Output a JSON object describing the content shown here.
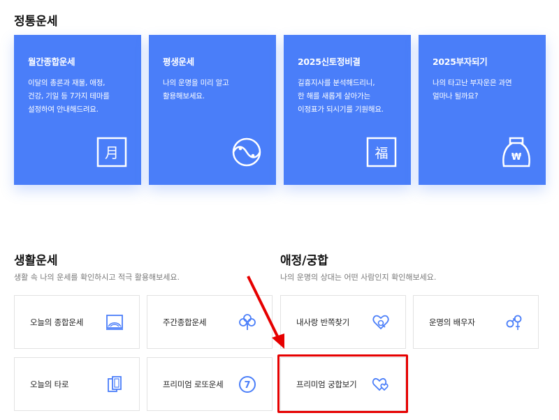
{
  "fortune": {
    "title": "정통운세",
    "cards": [
      {
        "title": "월간종합운세",
        "desc": "이달의 총론과 재물, 애정,\n건강, 기일 등 7가지 테마를\n설정하여 안내해드려요.",
        "icon": "calendar-month-icon",
        "glyph": "月"
      },
      {
        "title": "평생운세",
        "desc": "나의 운명을 미리 알고\n활용해보세요.",
        "icon": "yin-yang-icon"
      },
      {
        "title": "2025신토정비결",
        "desc": "길흉지사를 분석해드리니,\n한 해를 새롭게 살아가는\n이정표가 되시기를 기원해요.",
        "icon": "fortune-bok-icon",
        "glyph": "福"
      },
      {
        "title": "2025부자되기",
        "desc": "나의 타고난 부자운은 과연\n얼마나 될까요?",
        "icon": "money-bag-icon",
        "glyph": "₩"
      }
    ]
  },
  "life": {
    "title": "생활운세",
    "desc": "생활 속 나의 운세를 확인하시고 적극 활용해보세요.",
    "items": [
      {
        "label": "오늘의 종합운세",
        "icon": "landscape-frame-icon"
      },
      {
        "label": "주간종합운세",
        "icon": "clover-icon"
      },
      {
        "label": "오늘의 타로",
        "icon": "tarot-cards-icon"
      },
      {
        "label": "프리미엄 로또운세",
        "icon": "lotto-ball-icon",
        "glyph": "7"
      }
    ]
  },
  "love": {
    "title": "애정/궁합",
    "desc": "나의 운명의 상대는 어떤 사람인지 확인해보세요.",
    "items": [
      {
        "label": "내사랑 반쪽찾기",
        "icon": "heart-search-icon"
      },
      {
        "label": "운명의 배우자",
        "icon": "gender-couple-icon"
      },
      {
        "label": "프리미엄 궁합보기",
        "icon": "double-heart-icon"
      }
    ]
  },
  "colors": {
    "accent": "#4a7ef9",
    "annotation": "#e60000"
  }
}
